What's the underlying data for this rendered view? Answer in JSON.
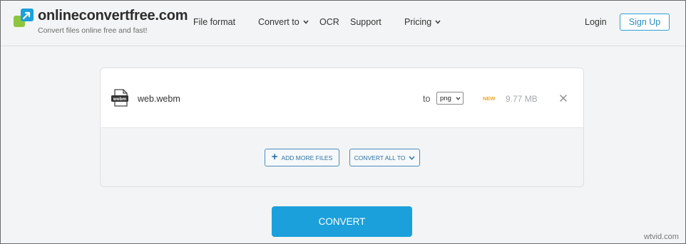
{
  "brand": {
    "title": "onlineconvertfree.com",
    "tagline": "Convert files online free and fast!"
  },
  "nav": {
    "file_format": "File format",
    "convert_to": "Convert to",
    "ocr": "OCR",
    "support": "Support",
    "pricing": "Pricing",
    "login": "Login",
    "signup": "Sign Up"
  },
  "file": {
    "icon_label": "webm",
    "name": "web.webm",
    "to_label": "to",
    "format_selected": "png",
    "badge": "NEW",
    "size": "9.77 MB"
  },
  "actions": {
    "add_more": "ADD MORE FILES",
    "add_more_icon": "+",
    "convert_all": "CONVERT ALL TO"
  },
  "convert_label": "CONVERT",
  "watermark": "wtvid.com",
  "colors": {
    "accent": "#1ba0dc",
    "badge": "#f5a623",
    "link": "#2a8fc6"
  }
}
